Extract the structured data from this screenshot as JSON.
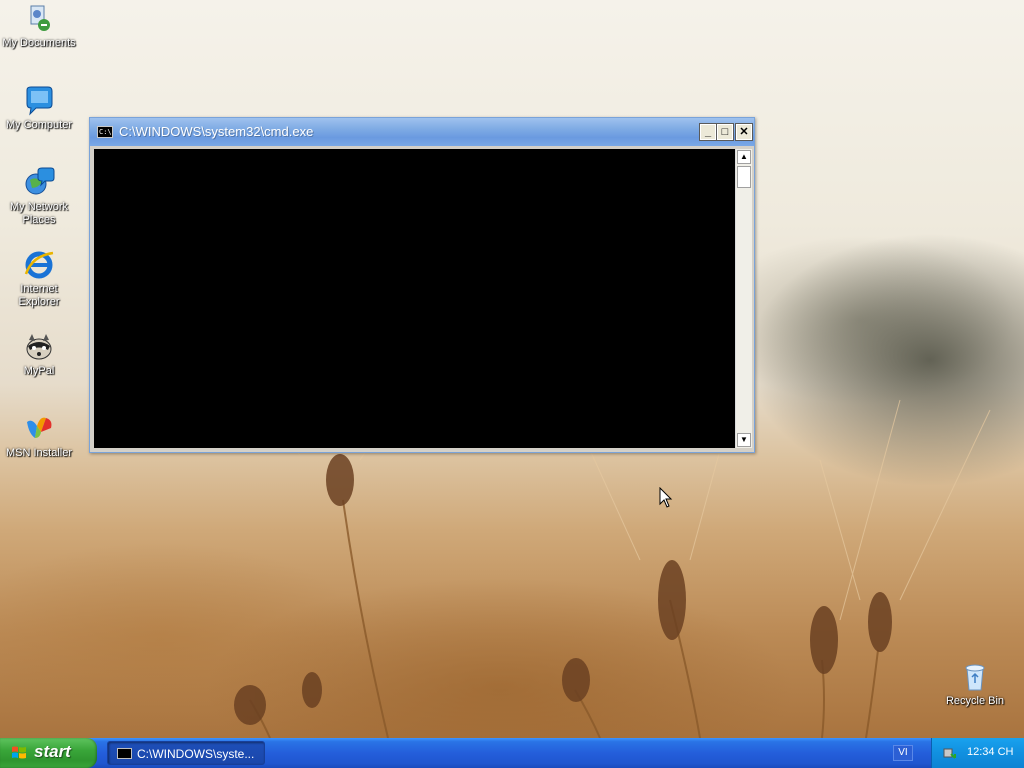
{
  "desktop": {
    "icons": [
      {
        "label": "My Documents",
        "icon": "my-documents-icon"
      },
      {
        "label": "My Computer",
        "icon": "my-computer-icon"
      },
      {
        "label": "My Network Places",
        "icon": "network-places-icon"
      },
      {
        "label": "Internet Explorer",
        "icon": "internet-explorer-icon"
      },
      {
        "label": "MyPal",
        "icon": "mypal-icon"
      },
      {
        "label": "MSN Installer",
        "icon": "msn-installer-icon"
      },
      {
        "label": "Recycle Bin",
        "icon": "recycle-bin-icon"
      }
    ]
  },
  "window": {
    "title": "C:\\WINDOWS\\system32\\cmd.exe",
    "icon_text": "C:\\",
    "buttons": {
      "minimize": "_",
      "maximize": "□",
      "close": "✕"
    },
    "scroll_up": "▲",
    "scroll_down": "▼"
  },
  "taskbar": {
    "start_label": "start",
    "task_label": "C:\\WINDOWS\\syste...",
    "language": "VI",
    "clock": "12:34 CH"
  },
  "colors": {
    "taskbar_blue": "#245edb",
    "start_green": "#3aa63a",
    "tray_blue": "#1190e0",
    "console_bg": "#000000"
  }
}
